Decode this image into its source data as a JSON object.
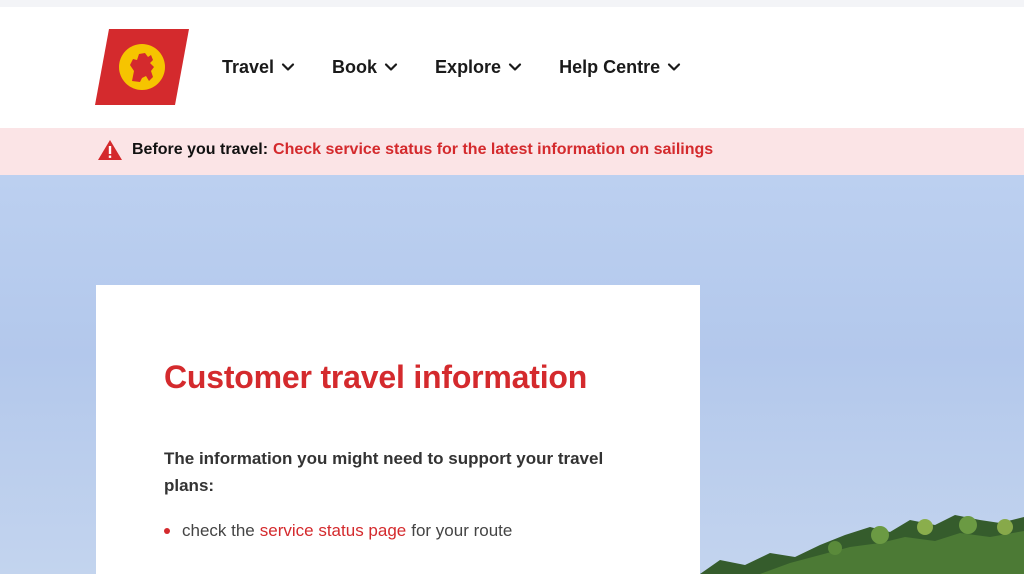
{
  "brand": {
    "primary_color": "#d42a2d",
    "logo_badge_color": "#f6c400",
    "logo_icon": "lion-rampant-icon"
  },
  "nav": {
    "items": [
      {
        "label": "Travel",
        "icon": "chevron-down-icon"
      },
      {
        "label": "Book",
        "icon": "chevron-down-icon"
      },
      {
        "label": "Explore",
        "icon": "chevron-down-icon"
      },
      {
        "label": "Help Centre",
        "icon": "chevron-down-icon"
      }
    ]
  },
  "alert": {
    "icon": "warning-triangle-icon",
    "prefix": "Before you travel:",
    "link_text": "Check service status for the latest information on sailings",
    "background": "#fbe4e6"
  },
  "card": {
    "title": "Customer travel information",
    "intro": "The information you might need to support your travel plans:",
    "list": [
      {
        "before": "check the",
        "link": "service status page",
        "after": "for your route"
      }
    ]
  }
}
